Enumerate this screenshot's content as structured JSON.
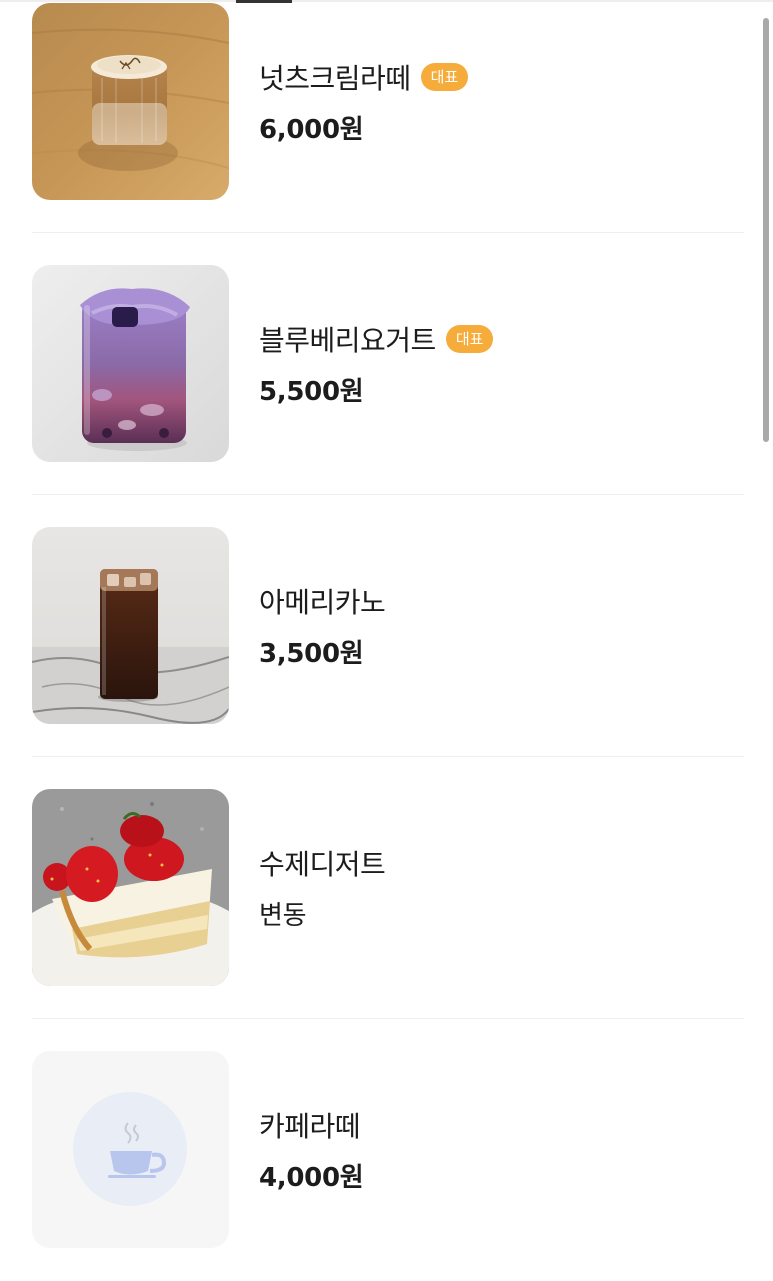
{
  "menu": {
    "items": [
      {
        "name": "넛츠크림라떼",
        "badge": "대표",
        "price": "6,000원",
        "image": "nut-cream-latte-photo"
      },
      {
        "name": "블루베리요거트",
        "badge": "대표",
        "price": "5,500원",
        "image": "blueberry-yogurt-photo"
      },
      {
        "name": "아메리카노",
        "price": "3,500원",
        "image": "americano-photo"
      },
      {
        "name": "수제디저트",
        "price": "변동",
        "image": "strawberry-cake-photo"
      },
      {
        "name": "카페라떼",
        "price": "4,000원",
        "image": "coffee-cup-icon"
      }
    ]
  },
  "colors": {
    "badge": "#f5ac3a",
    "divider": "#efefef",
    "placeholder_bg": "#f6f6f7",
    "placeholder_circle": "#e9edf6",
    "cup_icon": "#b8c6ee"
  }
}
